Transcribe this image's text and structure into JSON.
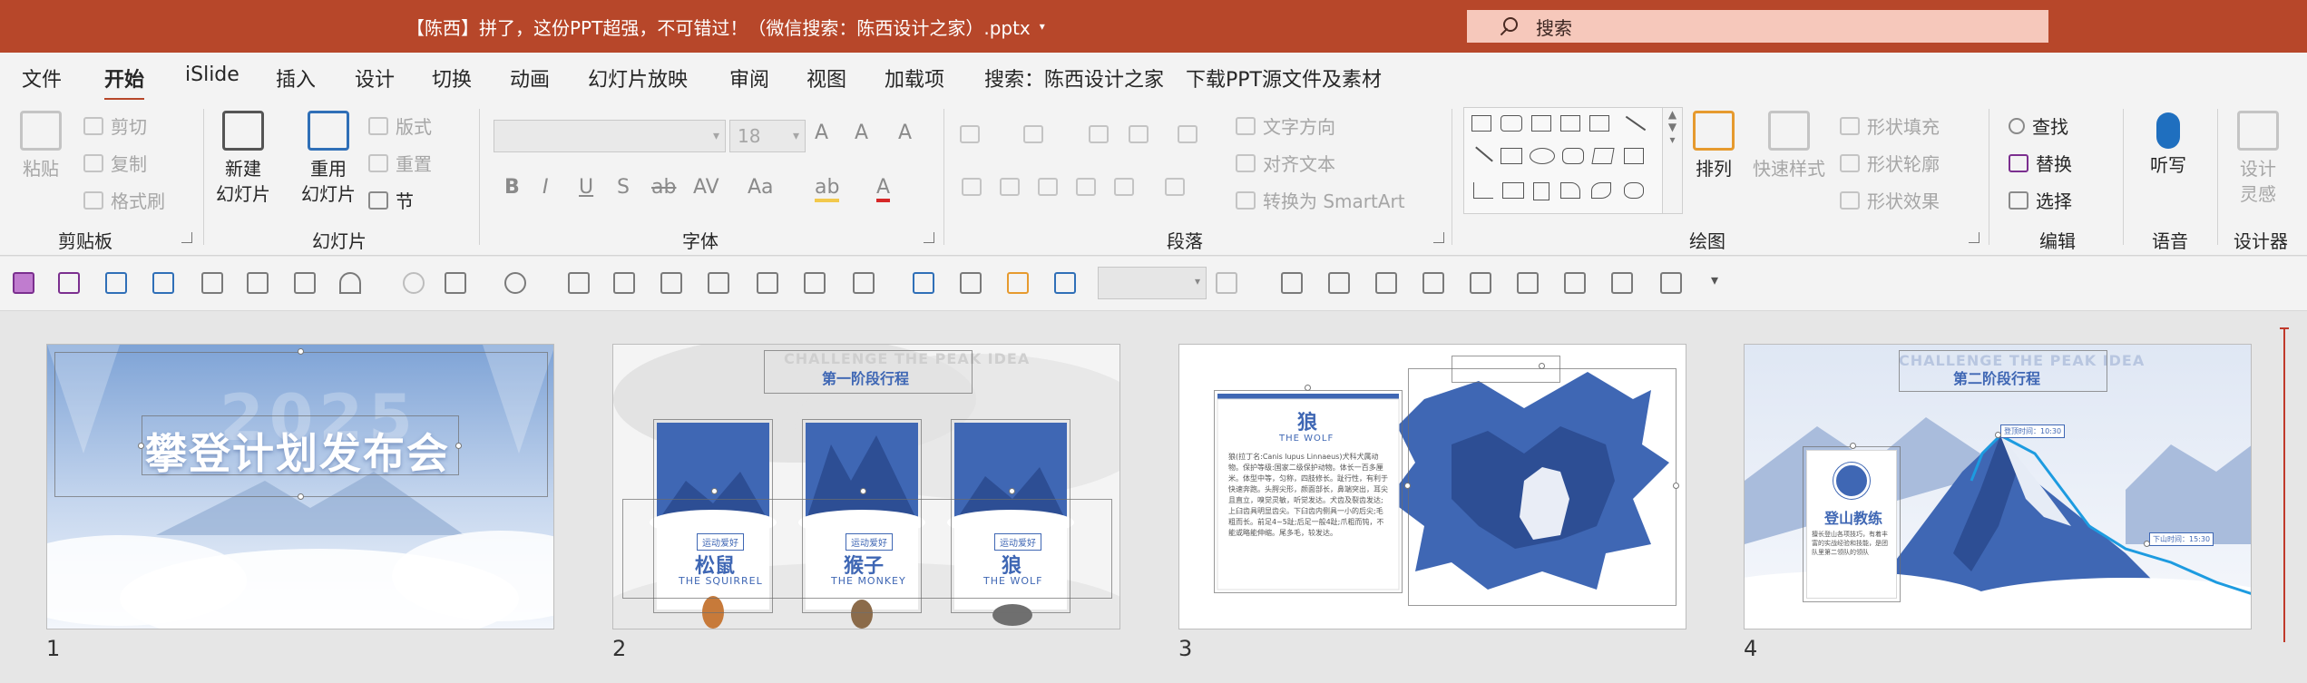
{
  "titlebar": {
    "doc_title": "【陈西】拼了，这份PPT超强，不可错过！（微信搜索：陈西设计之家）.pptx",
    "caret": "▾",
    "search_placeholder": "搜索"
  },
  "menu_tabs": [
    "文件",
    "开始",
    "iSlide",
    "插入",
    "设计",
    "切换",
    "动画",
    "幻灯片放映",
    "审阅",
    "视图",
    "加载项",
    "搜索：陈西设计之家",
    "下载PPT源文件及素材"
  ],
  "active_tab": "开始",
  "ribbon": {
    "clipboard": {
      "label": "剪贴板",
      "paste": "粘贴",
      "cut": "剪切",
      "copy": "复制",
      "format_painter": "格式刷"
    },
    "slides": {
      "label": "幻灯片",
      "new_slide": "新建",
      "new_slide_2": "幻灯片",
      "reuse": "重用",
      "reuse_2": "幻灯片",
      "layout": "版式",
      "reset": "重置",
      "section": "节"
    },
    "font": {
      "label": "字体",
      "font_name": "",
      "font_size": "18",
      "bold": "B",
      "italic": "I",
      "underline": "U",
      "strike": "S",
      "strike2": "ab",
      "spacing": "AV",
      "case": "Aa",
      "grow": "A",
      "shrink": "A",
      "clear": "A",
      "highlight": "ab",
      "color": "A"
    },
    "paragraph": {
      "label": "段落",
      "text_direction": "文字方向",
      "align_text": "对齐文本",
      "smartart": "转换为 SmartArt"
    },
    "drawing": {
      "label": "绘图",
      "arrange": "排列",
      "quick_styles": "快速样式",
      "shape_fill": "形状填充",
      "shape_outline": "形状轮廓",
      "shape_effects": "形状效果"
    },
    "editing": {
      "label": "编辑",
      "find": "查找",
      "replace": "替换",
      "select": "选择"
    },
    "voice": {
      "label": "语音",
      "dictate": "听写"
    },
    "designer": {
      "label": "设计器",
      "design_ideas": "设计",
      "design_ideas_2": "灵感"
    }
  },
  "slides": [
    {
      "number": "1",
      "title": "攀登计划发布会",
      "bg_text": "2025"
    },
    {
      "number": "2",
      "title": "第一阶段行程",
      "bg_text": "CHALLENGE THE PEAK IDEA",
      "cards": [
        {
          "tag": "运动爱好",
          "name": "松鼠",
          "en": "THE SQUIRREL"
        },
        {
          "tag": "运动爱好",
          "name": "猴子",
          "en": "THE MONKEY"
        },
        {
          "tag": "运动爱好",
          "name": "狼",
          "en": "THE WOLF"
        }
      ]
    },
    {
      "number": "3",
      "name": "狼",
      "en": "THE WOLF",
      "body": "狼(拉丁名:Canis lupus Linnaeus)犬科犬属动物。保护等级:国家二级保护动物。体长一百多厘米。体型中等，匀称，四肢修长。趾行性，有利于快速奔跑。头腭尖形，颜面部长，鼻端突出，耳尖且直立，嗅觉灵敏，听觉发达。犬齿及裂齿发达;上臼齿具明显齿尖。下臼齿内侧具一小的后尖;毛粗而长。前足4~5趾;后足一般4趾;爪粗而钝，不能或略能伸缩。尾多毛，较发达。"
    },
    {
      "number": "4",
      "title": "第二阶段行程",
      "bg_text": "CHALLENGE THE PEAK IDEA",
      "card_name": "登山教练",
      "card_body": "擅长登山各项技巧，有着丰富的实战经验和技能，是团队里第二领队的领队",
      "label_up": "登顶时间：10:30",
      "label_down": "下山时间：15:30"
    }
  ],
  "colors": {
    "accent": "#b7472a",
    "slide_blue": "#3f67b4",
    "highlight_yellow": "#f2c94c",
    "font_red": "#d62828"
  }
}
